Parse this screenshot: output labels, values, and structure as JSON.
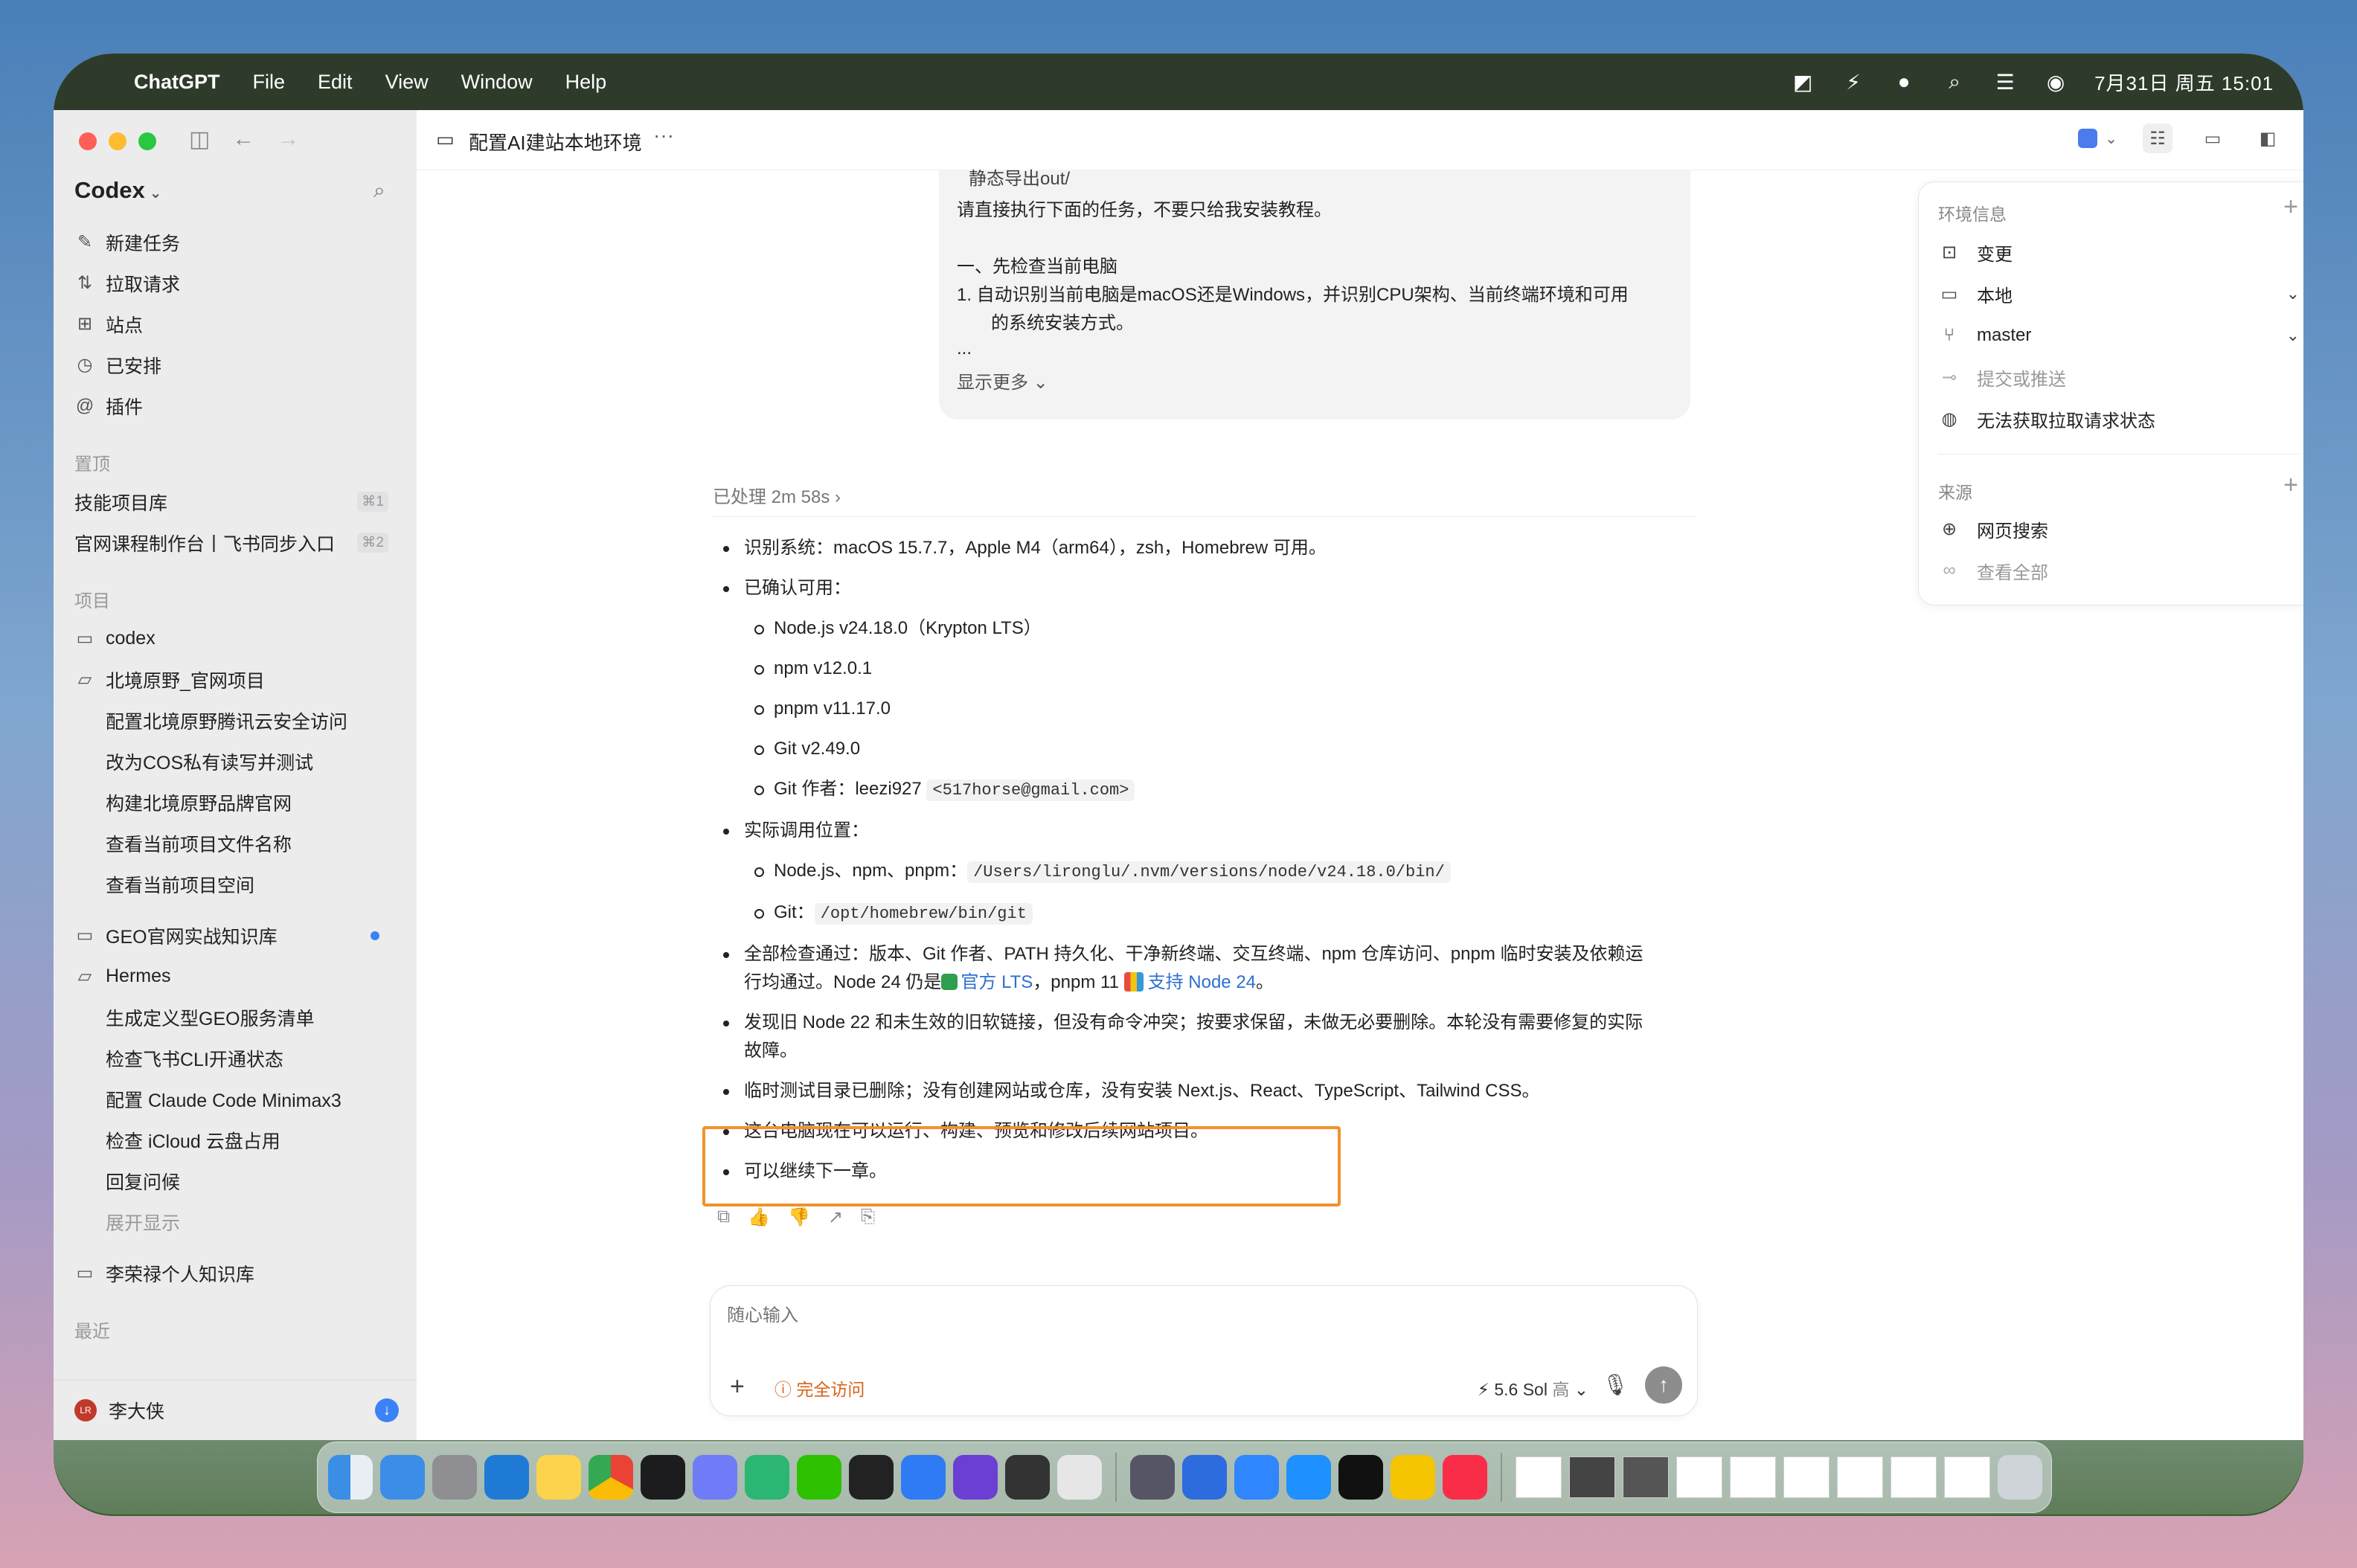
{
  "menubar": {
    "app": "ChatGPT",
    "items": [
      "File",
      "Edit",
      "View",
      "Window",
      "Help"
    ],
    "clock": "7月31日 周五  15:01"
  },
  "sidebar": {
    "title": "Codex",
    "nav": [
      {
        "label": "新建任务",
        "icon": "edit-icon"
      },
      {
        "label": "拉取请求",
        "icon": "pull-request-icon"
      },
      {
        "label": "站点",
        "icon": "grid-icon"
      },
      {
        "label": "已安排",
        "icon": "clock-icon"
      },
      {
        "label": "插件",
        "icon": "plugin-icon"
      }
    ],
    "pinned_header": "置顶",
    "pinned": [
      {
        "label": "技能项目库",
        "shortcut": "⌘1"
      },
      {
        "label": "官网课程制作台丨飞书同步入口",
        "shortcut": "⌘2"
      }
    ],
    "projects_header": "项目",
    "projects": [
      {
        "label": "codex",
        "children": []
      },
      {
        "label": "北境原野_官网项目",
        "children": [
          "配置北境原野腾讯云安全访问",
          "改为COS私有读写并测试",
          "构建北境原野品牌官网",
          "查看当前项目文件名称",
          "查看当前项目空间"
        ]
      },
      {
        "label": "GEO官网实战知识库",
        "children": [],
        "unread": true
      },
      {
        "label": "Hermes",
        "children": [
          "生成定义型GEO服务清单",
          "检查飞书CLI开通状态",
          "配置 Claude Code Minimax3",
          "检查 iCloud 云盘占用",
          "回复问候"
        ]
      }
    ],
    "expand_label": "展开显示",
    "kb": "李荣禄个人知识库",
    "recent_header": "最近",
    "user": {
      "name": "李大侠",
      "initials": "LR"
    }
  },
  "topbar": {
    "title": "配置AI建站本地环境"
  },
  "user_message": {
    "clipped_top": "静态导出out/",
    "line1": "请直接执行下面的任务，不要只给我安装教程。",
    "line2": "一、先检查当前电脑",
    "line3": "1. 自动识别当前电脑是macOS还是Windows，并识别CPU架构、当前终端环境和可用",
    "line4": "的系统安装方式。",
    "ellipsis": "...",
    "show_more": "显示更多"
  },
  "processed": "已处理 2m 58s",
  "answer": {
    "b1": "识别系统：macOS 15.7.7，Apple M4（arm64），zsh，Homebrew 可用。",
    "b2": "已确认可用：",
    "s1": "Node.js v24.18.0（Krypton LTS）",
    "s2": "npm v12.0.1",
    "s3": "pnpm v11.17.0",
    "s4": "Git v2.49.0",
    "s5_prefix": "Git 作者：leezi927 ",
    "s5_code": "<517horse@gmail.com>",
    "b3": "实际调用位置：",
    "s6_prefix": "Node.js、npm、pnpm：",
    "s6_code": "/Users/lironglu/.nvm/versions/node/v24.18.0/bin/",
    "s7_prefix": "Git：",
    "s7_code": "/opt/homebrew/bin/git",
    "b4_a": "全部检查通过：版本、Git 作者、PATH 持久化、干净新终端、交互终端、npm 仓库访问、pnpm 临时安装及依赖运",
    "b4_b": "行均通过。Node 24 仍是",
    "b4_link1": "官方 LTS",
    "b4_c": "，pnpm 11 ",
    "b4_link2": "支持 Node 24",
    "b4_d": "。",
    "b5_a": "发现旧 Node 22 和未生效的旧软链接，但没有命令冲突；按要求保留，未做无必要删除。本轮没有需要修复的实际",
    "b5_b": "故障。",
    "b6": "临时测试目录已删除；没有创建网站或仓库，没有安装 Next.js、React、TypeScript、Tailwind CSS。",
    "b7": "这台电脑现在可以运行、构建、预览和修改后续网站项目。",
    "b8": "可以继续下一章。"
  },
  "composer": {
    "placeholder": "随心输入",
    "access": "完全访问",
    "model": "5.6 Sol",
    "effort": "高"
  },
  "panel": {
    "env_header": "环境信息",
    "env_rows": [
      {
        "label": "变更",
        "icon": "diff-icon",
        "muted": false
      },
      {
        "label": "本地",
        "icon": "laptop-icon",
        "muted": false,
        "chevron": true
      },
      {
        "label": "master",
        "icon": "branch-icon",
        "muted": false,
        "chevron": true
      },
      {
        "label": "提交或推送",
        "icon": "commit-icon",
        "muted": true
      },
      {
        "label": "无法获取拉取请求状态",
        "icon": "github-icon",
        "muted": false
      }
    ],
    "source_header": "来源",
    "source_rows": [
      {
        "label": "网页搜索",
        "icon": "globe-icon",
        "muted": false
      },
      {
        "label": "查看全部",
        "icon": "link-icon",
        "muted": true
      }
    ]
  },
  "colors": {
    "accent": "#3b82f6",
    "highlight": "#f0922b",
    "access": "#d9621a"
  }
}
